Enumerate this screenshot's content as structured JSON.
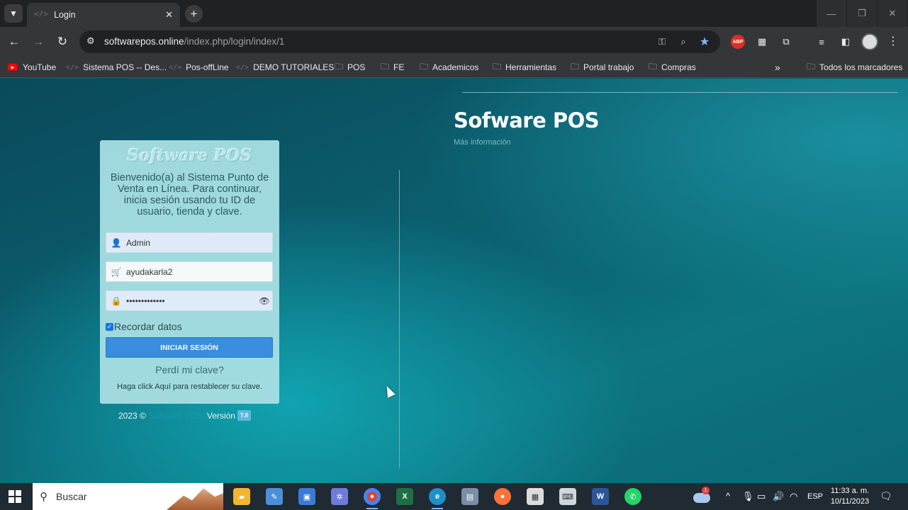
{
  "browser": {
    "tab_title": "Login",
    "tab_favicon": "</>",
    "url_host": "softwarepos.online",
    "url_path": "/index.php/login/index/1",
    "bookmarks": [
      {
        "label": "YouTube",
        "icon": "youtube-icon"
      },
      {
        "label": "Sistema POS -- Des...",
        "icon": "code-icon"
      },
      {
        "label": "Pos-offLine",
        "icon": "code-icon"
      },
      {
        "label": "DEMO TUTORIALES",
        "icon": "code-icon"
      },
      {
        "label": "POS",
        "icon": "folder-icon"
      },
      {
        "label": "FE",
        "icon": "folder-icon"
      },
      {
        "label": "Academicos",
        "icon": "folder-icon"
      },
      {
        "label": "Herramientas",
        "icon": "folder-icon"
      },
      {
        "label": "Portal trabajo",
        "icon": "folder-icon"
      },
      {
        "label": "Compras",
        "icon": "folder-icon"
      }
    ],
    "all_bookmarks": "Todos los marcadores",
    "abp_label": "ABP"
  },
  "page": {
    "brand_title": "Sofware POS",
    "more_info": "Más información"
  },
  "login": {
    "logo_text": "Software POS",
    "welcome": "Bienvenido(a) al Sistema Punto de Venta en Línea. Para continuar, inicia sesión usando tu ID de usuario, tienda y clave.",
    "user_value": "Admin",
    "store_value": "ayudakarla2",
    "password_mask": "•••••••••••••",
    "remember_label": "Recordar datos",
    "remember_checked": true,
    "submit_label": "INICIAR SESIÓN",
    "forgot_label": "Perdí mi clave?",
    "reset_prefix": "Haga click ",
    "reset_link": "Aquí",
    "reset_suffix": " para restablecer su clave."
  },
  "footer": {
    "year": "2023 ©",
    "brand": "Software POS",
    "version_label": "Versión",
    "version_number": "7.0"
  },
  "taskbar": {
    "search_placeholder": "Buscar",
    "weather_badge": "1",
    "language": "ESP",
    "time": "11:33 a. m.",
    "date": "10/11/2023",
    "apps": [
      {
        "name": "file-explorer",
        "color": "#f2b632",
        "glyph": "▰"
      },
      {
        "name": "paint-app",
        "color": "#4b8fd8",
        "glyph": "✎"
      },
      {
        "name": "remote-desktop",
        "color": "#3a7bd5",
        "glyph": "▣"
      },
      {
        "name": "settings-app",
        "color": "#6d7dd8",
        "glyph": "✲"
      },
      {
        "name": "chrome",
        "color": "#db4437",
        "glyph": "●"
      },
      {
        "name": "excel",
        "color": "#1d7044",
        "glyph": "X"
      },
      {
        "name": "edge",
        "color": "#1f8fc8",
        "glyph": "e"
      },
      {
        "name": "network-app",
        "color": "#7a8ea8",
        "glyph": "▤"
      },
      {
        "name": "firefox",
        "color": "#ff7139",
        "glyph": "●"
      },
      {
        "name": "viewer-app",
        "color": "#dcdcdc",
        "glyph": "▦"
      },
      {
        "name": "keyboard-app",
        "color": "#cfd6dd",
        "glyph": "⌨"
      },
      {
        "name": "word",
        "color": "#2b579a",
        "glyph": "W"
      },
      {
        "name": "whatsapp",
        "color": "#25d366",
        "glyph": "✆"
      }
    ]
  }
}
